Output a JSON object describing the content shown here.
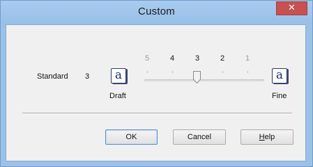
{
  "window": {
    "title": "Custom",
    "close_glyph": "✕"
  },
  "quality": {
    "label": "Standard",
    "value": "3",
    "draft_glyph": "a",
    "fine_glyph": "a",
    "draft_label": "Draft",
    "fine_label": "Fine"
  },
  "slider": {
    "ticks": [
      "5",
      "4",
      "3",
      "2",
      "1"
    ],
    "selected": "3"
  },
  "buttons": {
    "ok": "OK",
    "cancel": "Cancel",
    "help_mnemonic": "H",
    "help_rest": "elp"
  }
}
